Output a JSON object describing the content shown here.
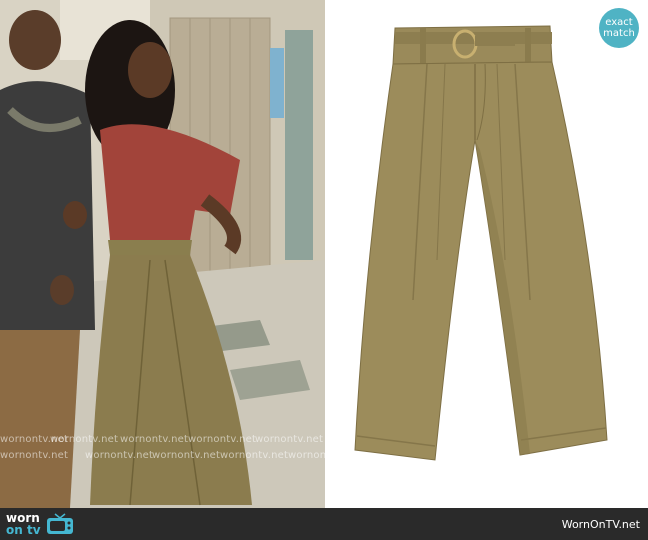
{
  "badge": {
    "line1": "exact",
    "line2": "match"
  },
  "footer": {
    "logo_top": "worn",
    "logo_bottom": "on tv",
    "site": "WornOnTV.net"
  },
  "watermark": {
    "text": "wornontv.net"
  },
  "colors": {
    "badge": "#4fb3c4",
    "footer_bg": "#2a2a2a",
    "pants": "#9a8a5a"
  }
}
